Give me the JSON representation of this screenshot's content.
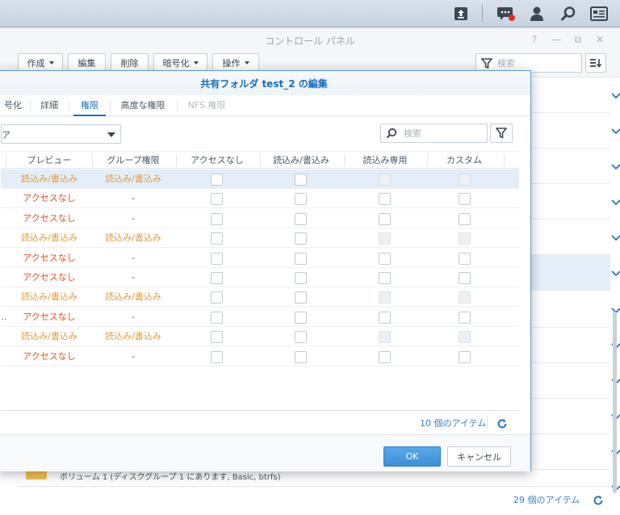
{
  "control_panel": {
    "title": "コントロール パネル",
    "window_controls": [
      "?",
      "—",
      "⧉",
      "✕"
    ],
    "toolbar": {
      "create": "作成",
      "edit": "編集",
      "delete": "削除",
      "encrypt": "暗号化",
      "action": "操作",
      "search_placeholder": "検索"
    },
    "volume_text": "ボリューム 1 (ディスクグループ 1 にあります, Basic, btrfs)",
    "item_count": "29 個のアイテム"
  },
  "dialog": {
    "title": "共有フォルダ test_2 の編集",
    "tabs": [
      "号化",
      "詳細",
      "権限",
      "高度な権限",
      "NFS 権限"
    ],
    "active_tab": "権限",
    "dropdown_value": "ア",
    "search_placeholder": "検索",
    "columns": [
      "プレビュー",
      "グループ権限",
      "アクセスなし",
      "読込み/書込み",
      "読込み専用",
      "カスタム"
    ],
    "rows": [
      {
        "lead": "",
        "preview": "読込み/書込み",
        "group": "読込み/書込み",
        "ro_disabled": true,
        "selected": true
      },
      {
        "lead": "",
        "preview": "アクセスなし",
        "group": "-",
        "ro_disabled": false
      },
      {
        "lead": "",
        "preview": "アクセスなし",
        "group": "-",
        "ro_disabled": false
      },
      {
        "lead": "",
        "preview": "読込み/書込み",
        "group": "読込み/書込み",
        "ro_disabled": true
      },
      {
        "lead": "",
        "preview": "アクセスなし",
        "group": "-",
        "ro_disabled": false
      },
      {
        "lead": "",
        "preview": "アクセスなし",
        "group": "-",
        "ro_disabled": false
      },
      {
        "lead": "",
        "preview": "読込み/書込み",
        "group": "読込み/書込み",
        "ro_disabled": true
      },
      {
        "lead": "..",
        "preview": "アクセスなし",
        "group": "-",
        "ro_disabled": false
      },
      {
        "lead": "",
        "preview": "読込み/書込み",
        "group": "読込み/書込み",
        "ro_disabled": true
      },
      {
        "lead": "",
        "preview": "アクセスなし",
        "group": "-",
        "ro_disabled": false
      }
    ],
    "item_count": "10 個のアイテム",
    "ok": "OK",
    "cancel": "キャンセル"
  },
  "colors": {
    "accent": "#1a6ec0",
    "no_access": "#e0512a",
    "read_write": "#e39a3a",
    "ok_button": "#4a9ce0"
  }
}
